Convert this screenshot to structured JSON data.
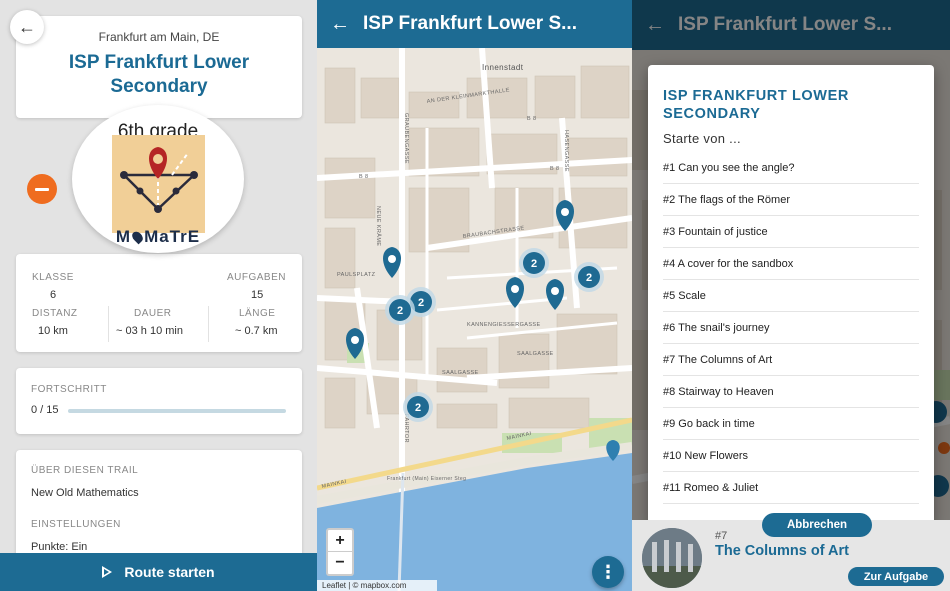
{
  "detail": {
    "location": "Frankfurt am Main, DE",
    "title": "ISP Frankfurt Lower Secondary",
    "grade_label": "6th grade",
    "brand": "M⁠MaTrE",
    "stats": {
      "klasse_label": "KLASSE",
      "klasse": "6",
      "aufgaben_label": "AUFGABEN",
      "aufgaben": "15",
      "distanz_label": "DISTANZ",
      "distanz": "10 km",
      "dauer_label": "DAUER",
      "dauer": "~ 03 h 10 min",
      "laenge_label": "LÄNGE",
      "laenge": "~ 0.7 km"
    },
    "progress": {
      "label": "FORTSCHRITT",
      "text": "0 / 15",
      "fraction": 0
    },
    "about_label": "ÜBER DIESEN TRAIL",
    "about_value": "New Old Mathematics",
    "settings_label": "EINSTELLUNGEN",
    "settings_value": "Punkte: Ein",
    "route_button": "Route starten"
  },
  "map_view": {
    "title": "ISP Frankfurt Lower S...",
    "street_labels": [
      "Innenstadt",
      "AN DER KLEINMARKTHALLE",
      "B 8",
      "B 8",
      "B 8",
      "GRAUBENGASSE",
      "HASENGASSE",
      "BRAUBACHSTRASSE",
      "NEUE KRÄME",
      "PAULSPLATZ",
      "KANNENGIESSERGASSE",
      "SAALGASSE",
      "SAALGASSE",
      "FAHRTOR",
      "MAINKAI",
      "MAINKAI",
      "Frankfurt (Main) Eiserner Steg"
    ],
    "clusters": [
      "2",
      "2",
      "2",
      "2",
      "2"
    ],
    "zoom_in": "+",
    "zoom_out": "−",
    "attribution": "Leaflet | © mapbox.com",
    "fab": "⋮"
  },
  "dialog": {
    "header_title": "ISP Frankfurt Lower S...",
    "title": "ISP FRANKFURT LOWER SECONDARY",
    "subtitle": "Starte von ...",
    "items": [
      "#1 Can you see the angle?",
      "#2 The flags of the Römer",
      "#3 Fountain of justice",
      "#4 A cover for the sandbox",
      "#5 Scale",
      "#6 The snail's journey",
      "#7 The Columns of Art",
      "#8 Stairway to Heaven",
      "#9 Go back in time",
      "#10 New Flowers",
      "#11 Romeo & Juliet"
    ],
    "cancel": "Abbrechen",
    "card_num": "#7",
    "card_title": "The Columns of Art",
    "card_button": "Zur Aufgabe"
  }
}
